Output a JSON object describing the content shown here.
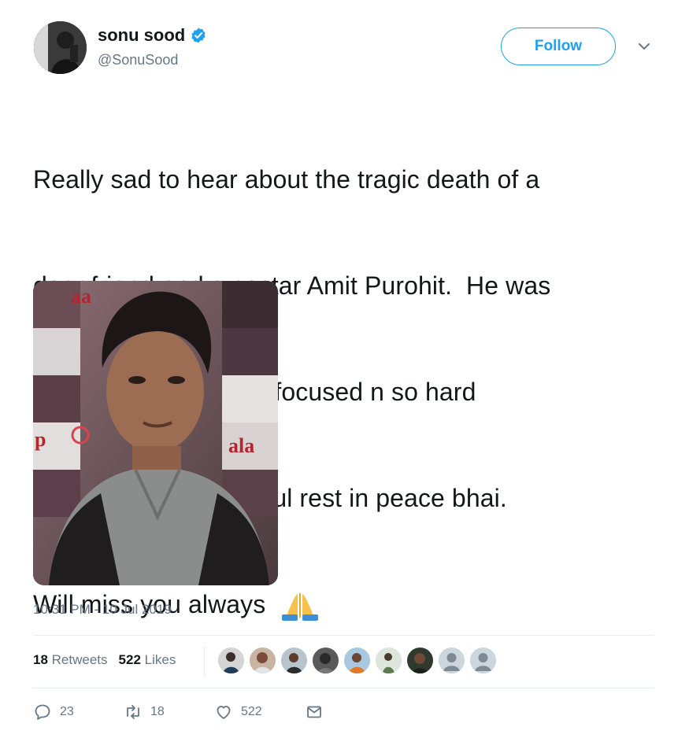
{
  "user": {
    "display_name": "sonu sood",
    "handle": "@SonuSood",
    "verified": true
  },
  "follow_label": "Follow",
  "tweet": {
    "lines": [
      "Really sad to hear about the tragic death of a",
      "dear friend and a costar Amit Purohit.  He was",
      "such a great soul, so focused n so hard",
      "working. May your soul rest in peace bhai.",
      "Will miss you always "
    ],
    "emoji": "folded-hands-emoji"
  },
  "timestamp": "10:31 PM - 10 Jul 2019",
  "stats": {
    "retweets_count": "18",
    "retweets_label": "Retweets",
    "likes_count": "522",
    "likes_label": "Likes"
  },
  "likers_count": 10,
  "actions": {
    "replies": "23",
    "retweets": "18",
    "likes": "522"
  },
  "colors": {
    "accent": "#1da1f2",
    "muted_text": "#657786",
    "divider": "#e6ecf0"
  }
}
